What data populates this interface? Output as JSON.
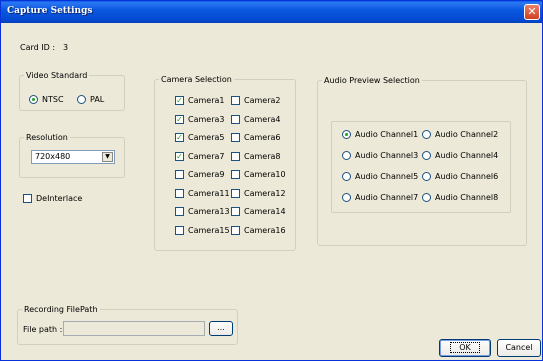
{
  "window": {
    "title": "Capture Settings"
  },
  "card": {
    "label": "Card ID :",
    "value": "3"
  },
  "video_standard": {
    "title": "Video Standard",
    "options": [
      {
        "label": "NTSC",
        "checked": true
      },
      {
        "label": "PAL",
        "checked": false
      }
    ]
  },
  "resolution": {
    "title": "Resolution",
    "value": "720x480"
  },
  "deinterlace": {
    "label": "DeInterlace",
    "checked": false
  },
  "camera_selection": {
    "title": "Camera Selection",
    "cameras": [
      {
        "label": "Camera1",
        "checked": true
      },
      {
        "label": "Camera2",
        "checked": false
      },
      {
        "label": "Camera3",
        "checked": true
      },
      {
        "label": "Camera4",
        "checked": false
      },
      {
        "label": "Camera5",
        "checked": true
      },
      {
        "label": "Camera6",
        "checked": false
      },
      {
        "label": "Camera7",
        "checked": true
      },
      {
        "label": "Camera8",
        "checked": false
      },
      {
        "label": "Camera9",
        "checked": false
      },
      {
        "label": "Camera10",
        "checked": false
      },
      {
        "label": "Camera11",
        "checked": false
      },
      {
        "label": "Camera12",
        "checked": false
      },
      {
        "label": "Camera13",
        "checked": false
      },
      {
        "label": "Camera14",
        "checked": false
      },
      {
        "label": "Camera15",
        "checked": false
      },
      {
        "label": "Camera16",
        "checked": false
      }
    ]
  },
  "audio_preview": {
    "title": "Audio Preview Selection",
    "channels": [
      {
        "label": "Audio Channel1",
        "checked": true
      },
      {
        "label": "Audio Channel2",
        "checked": false
      },
      {
        "label": "Audio Channel3",
        "checked": false
      },
      {
        "label": "Audio Channel4",
        "checked": false
      },
      {
        "label": "Audio Channel5",
        "checked": false
      },
      {
        "label": "Audio Channel6",
        "checked": false
      },
      {
        "label": "Audio Channel7",
        "checked": false
      },
      {
        "label": "Audio Channel8",
        "checked": false
      }
    ]
  },
  "recording": {
    "title": "Recording FilePath",
    "file_label": "File path :",
    "file_value": "",
    "browse_label": "..."
  },
  "buttons": {
    "ok": "OK",
    "cancel": "Cancel"
  }
}
